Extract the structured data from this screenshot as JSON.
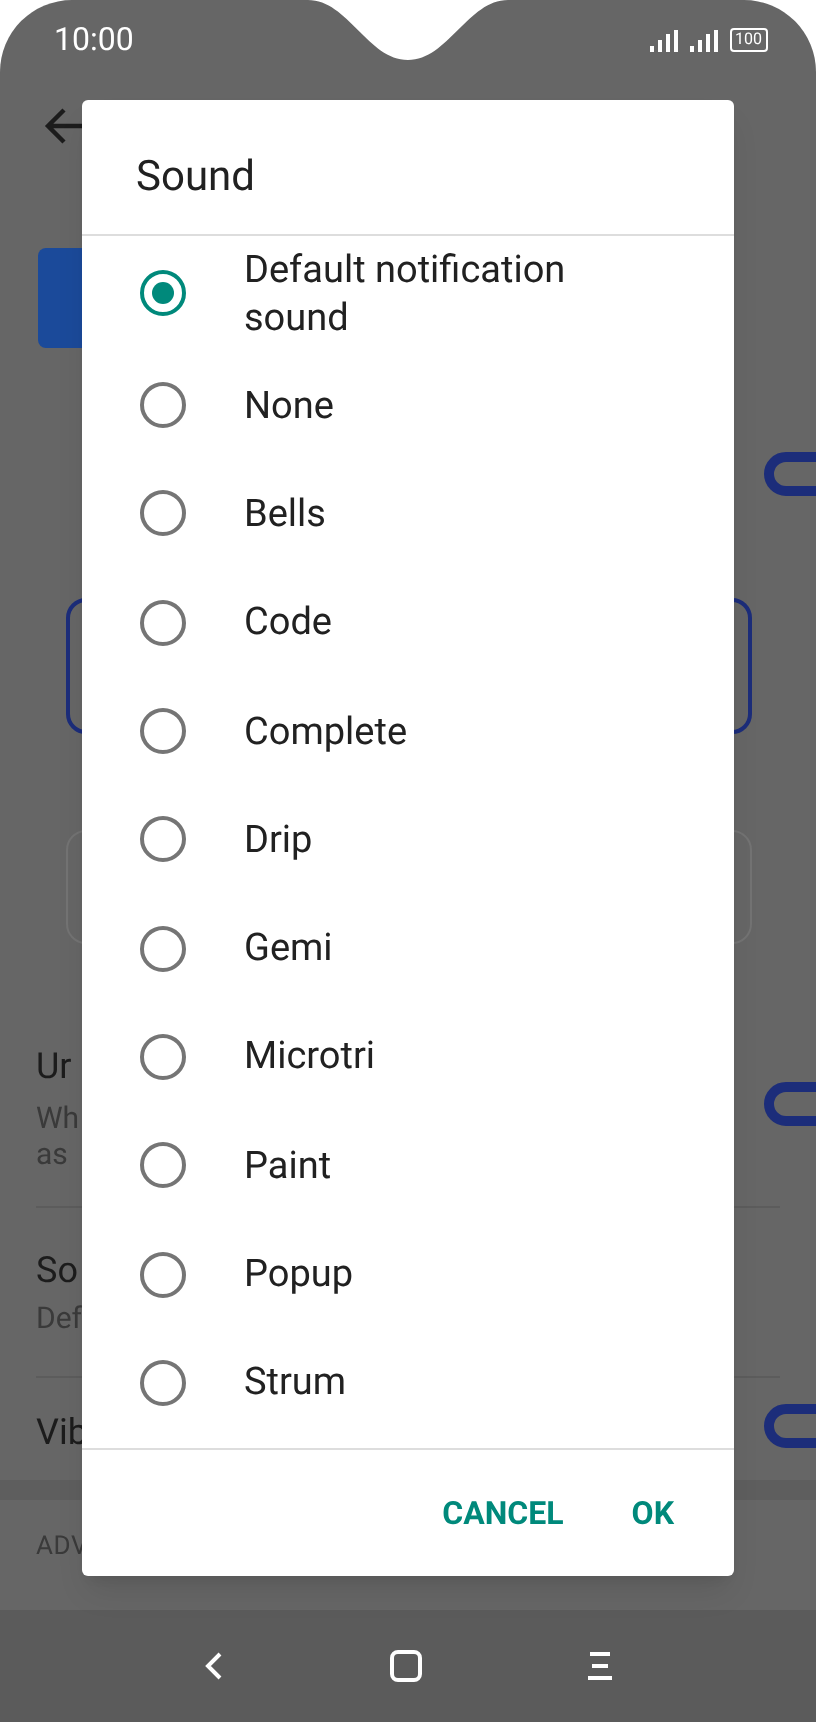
{
  "status_bar": {
    "time": "10:00",
    "battery": "100"
  },
  "background": {
    "texts": [
      {
        "kind": "title",
        "text": "Ur"
      },
      {
        "kind": "sub",
        "text": "Wh"
      },
      {
        "kind": "sub",
        "text": "as"
      },
      {
        "kind": "title",
        "text": "So"
      },
      {
        "kind": "sub",
        "text": "Def"
      },
      {
        "kind": "title",
        "text": "Vib"
      },
      {
        "kind": "section",
        "text": "ADV"
      }
    ],
    "toggles": [
      {
        "on": true
      },
      {
        "on": true
      },
      {
        "on": true
      }
    ]
  },
  "dialog": {
    "title": "Sound",
    "options": [
      {
        "label": "Default notification sound",
        "selected": true
      },
      {
        "label": "None",
        "selected": false
      },
      {
        "label": "Bells",
        "selected": false
      },
      {
        "label": "Code",
        "selected": false
      },
      {
        "label": "Complete",
        "selected": false
      },
      {
        "label": "Drip",
        "selected": false
      },
      {
        "label": "Gemi",
        "selected": false
      },
      {
        "label": "Microtri",
        "selected": false
      },
      {
        "label": "Paint",
        "selected": false
      },
      {
        "label": "Popup",
        "selected": false
      },
      {
        "label": "Strum",
        "selected": false
      }
    ],
    "buttons": [
      "CANCEL",
      "OK"
    ]
  }
}
